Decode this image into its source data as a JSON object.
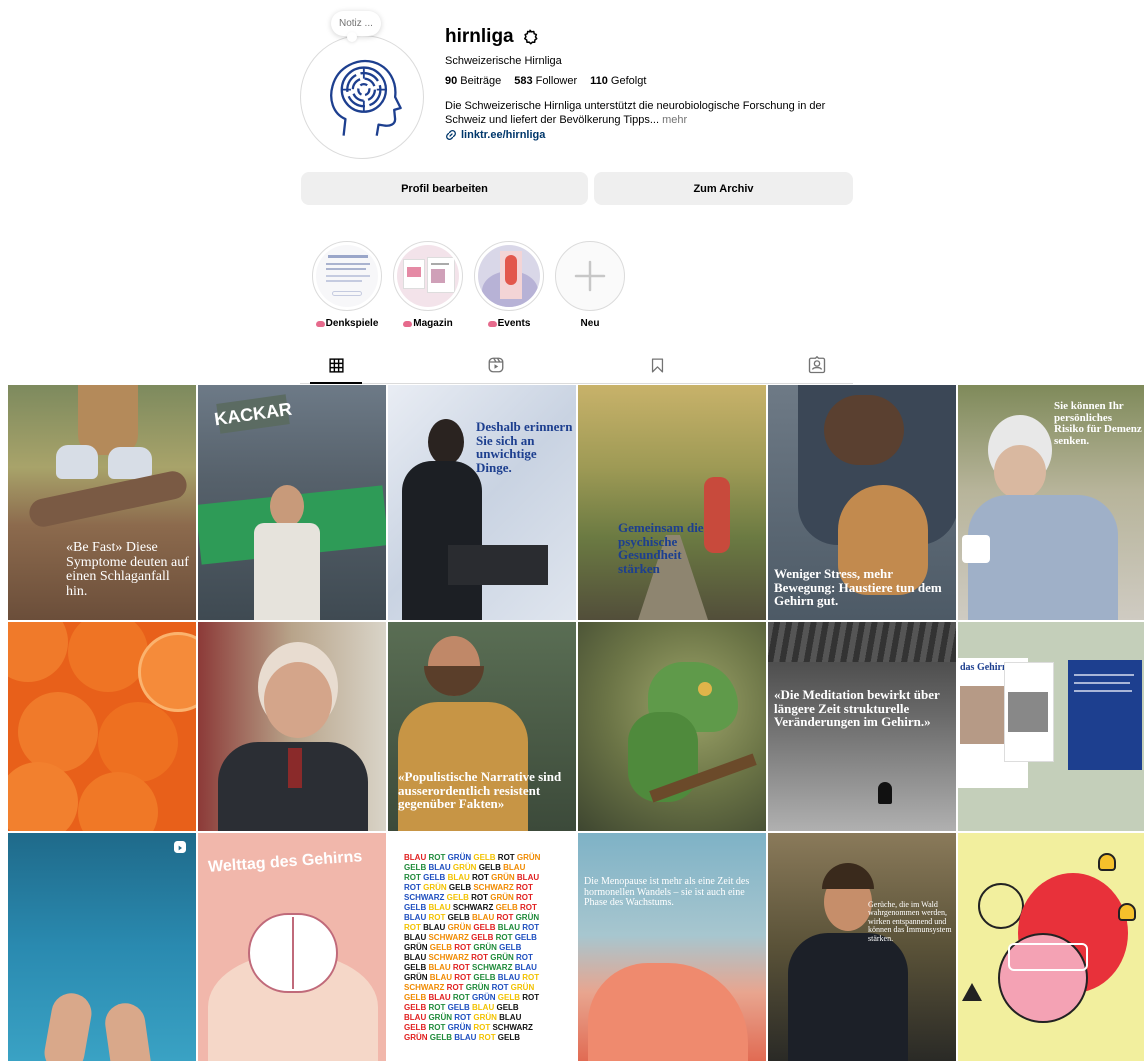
{
  "profile": {
    "note": "Notiz ...",
    "username": "hirnliga",
    "full_name": "Schweizerische Hirnliga",
    "stats": [
      {
        "count": "90",
        "label": "Beiträge"
      },
      {
        "count": "583",
        "label": "Follower"
      },
      {
        "count": "110",
        "label": "Gefolgt"
      }
    ],
    "bio": "Die Schweizerische Hirnliga unterstützt die neurobiologische Forschung in der Schweiz und liefert der Bevölkerung Tipps...",
    "bio_more": "mehr",
    "link": "linktr.ee/hirnliga"
  },
  "buttons": {
    "edit": "Profil bearbeiten",
    "archive": "Zum Archiv"
  },
  "highlights": [
    {
      "label": "Denkspiele",
      "brain": true
    },
    {
      "label": "Magazin",
      "brain": true
    },
    {
      "label": "Events",
      "brain": true
    },
    {
      "label": "Neu",
      "brain": false
    }
  ],
  "tabs": [
    {
      "name": "posts",
      "icon": "grid-icon"
    },
    {
      "name": "reels",
      "icon": "reels-icon"
    },
    {
      "name": "saved",
      "icon": "bookmark-icon"
    },
    {
      "name": "tagged",
      "icon": "tagged-icon"
    }
  ],
  "posts": [
    {
      "caption": "«Be Fast» Diese Symptome deuten auf einen Schlaganfall hin."
    },
    {
      "caption": "KACKAR"
    },
    {
      "caption": "Deshalb erinnern Sie sich an unwichtige Dinge."
    },
    {
      "caption": "Gemeinsam die psychische Gesundheit stärken"
    },
    {
      "caption": "Weniger Stress, mehr Bewegung: Haustiere tun dem Gehirn gut."
    },
    {
      "caption": "Sie können Ihr persönliches Risiko für Demenz senken."
    },
    {
      "caption": ""
    },
    {
      "caption": ""
    },
    {
      "caption": "«Populistische Narrative sind ausserordentlich resistent gegenüber Fakten»"
    },
    {
      "caption": ""
    },
    {
      "caption": "«Die Meditation bewirkt über längere Zeit strukturelle Veränderungen im Gehirn.»"
    },
    {
      "caption": "das Gehirn"
    },
    {
      "caption": ""
    },
    {
      "caption": "Welttag des Gehirns"
    },
    {
      "caption": ""
    },
    {
      "caption": "Die Menopause ist mehr als eine Zeit des hormonellen Wandels – sie ist auch eine Phase des Wachstums."
    },
    {
      "caption": "Gerüche, die im Wald wahrgenommen werden, wirken entspannend und können das Immunsystem stärken."
    },
    {
      "caption": ""
    }
  ],
  "stroop_lines": [
    "BLAU ROT GRÜN GELB ROT GRÜN",
    "GELB BLAU GRÜN GELB BLAU",
    "ROT GELB BLAU ROT GRÜN BLAU",
    "ROT GRÜN GELB SCHWARZ ROT",
    "SCHWARZ GELB ROT GRÜN ROT",
    "GELB BLAU SCHWARZ GELB ROT",
    "BLAU ROT GELB BLAU ROT GRÜN",
    "ROT BLAU GRÜN GELB BLAU ROT",
    "BLAU SCHWARZ GELB ROT GELB",
    "GRÜN GELB ROT GRÜN GELB",
    "BLAU SCHWARZ ROT GRÜN ROT",
    "GELB BLAU ROT SCHWARZ BLAU",
    "GRÜN BLAU ROT GELB BLAU ROT",
    "SCHWARZ ROT GRÜN ROT GRÜN",
    "GELB BLAU ROT GRÜN GELB ROT",
    "GELB ROT GELB BLAU GELB",
    "BLAU GRÜN ROT GRÜN BLAU",
    "GELB ROT GRÜN ROT SCHWARZ",
    "GRÜN GELB BLAU ROT GELB"
  ],
  "stroop_colors": [
    "#e02020",
    "#1f8a3a",
    "#1f4fbf",
    "#f2c200",
    "#111111",
    "#f08a00"
  ],
  "colors": {
    "brand_blue": "#1d3f8f",
    "link": "#00376b",
    "button_bg": "#efefef",
    "border": "#dbdbdb"
  }
}
